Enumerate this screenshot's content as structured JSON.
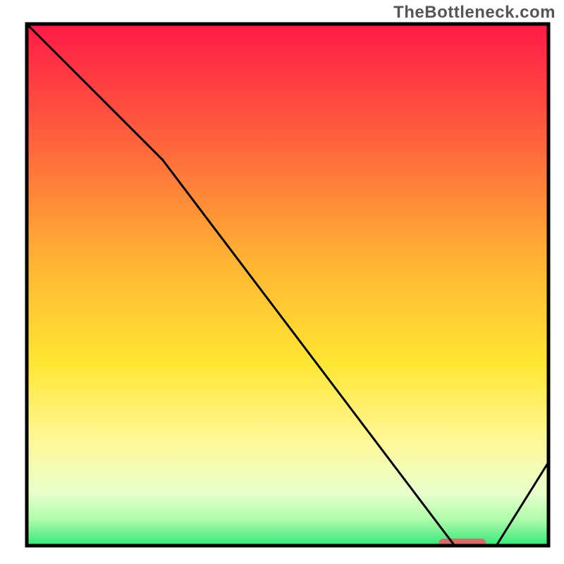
{
  "watermark": "TheBottleneck.com",
  "chart_data": {
    "type": "line",
    "title": "",
    "xlabel": "",
    "ylabel": "",
    "xlim": [
      0,
      100
    ],
    "ylim": [
      0,
      100
    ],
    "grid": false,
    "legend": false,
    "x": [
      0,
      26,
      82,
      90,
      100
    ],
    "y": [
      100,
      74,
      0,
      0,
      16
    ],
    "optimal_marker": {
      "x_start": 79,
      "x_end": 88,
      "y": 0,
      "color": "#d86a6a"
    },
    "gradient_stops": [
      {
        "offset": 0.0,
        "color": "#ff1a47"
      },
      {
        "offset": 0.2,
        "color": "#ff5a3e"
      },
      {
        "offset": 0.45,
        "color": "#ffb233"
      },
      {
        "offset": 0.65,
        "color": "#ffe633"
      },
      {
        "offset": 0.8,
        "color": "#fff899"
      },
      {
        "offset": 0.9,
        "color": "#e8ffcc"
      },
      {
        "offset": 0.95,
        "color": "#aefcaa"
      },
      {
        "offset": 1.0,
        "color": "#34e77a"
      }
    ],
    "frame_color": "#000000",
    "line_color": "#000000",
    "line_width": 3
  }
}
